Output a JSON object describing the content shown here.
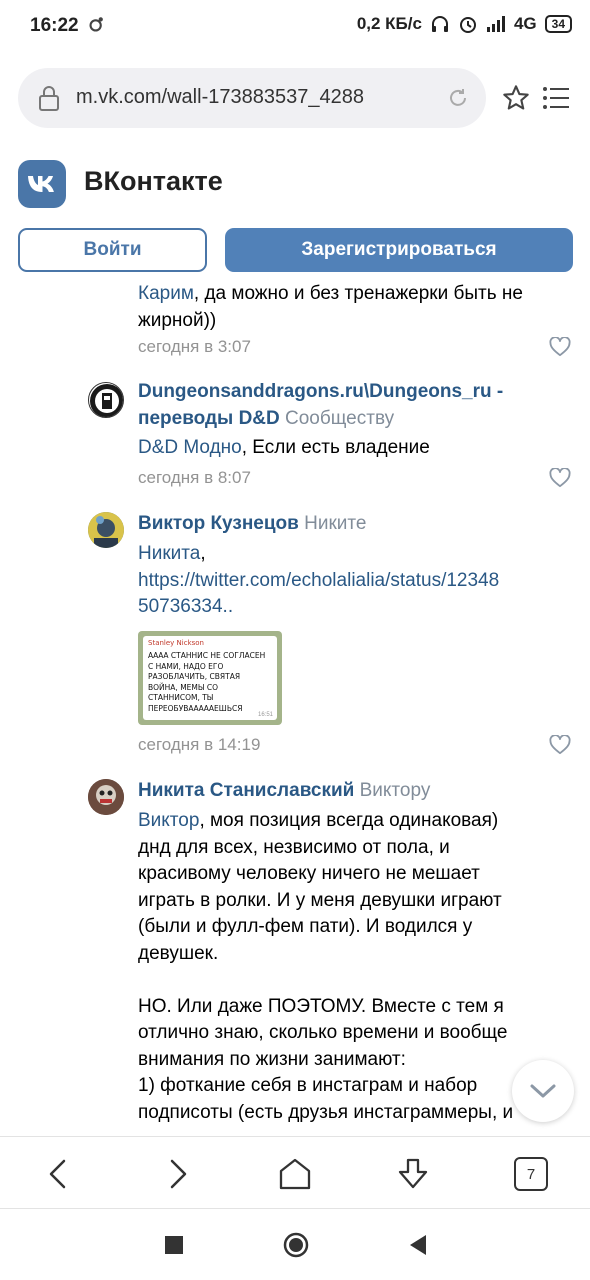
{
  "status_bar": {
    "time": "16:22",
    "network_speed": "0,2 КБ/с",
    "network_type": "4G",
    "battery": "34"
  },
  "browser": {
    "url": "m.vk.com/wall-173883537_4288",
    "tabs_count": "7"
  },
  "vk_header": {
    "title": "ВКонтакте",
    "login_label": "Войти",
    "register_label": "Зарегистрироваться",
    "accent": "#4a76a8"
  },
  "comments": [
    {
      "reply_to_name": "Карим",
      "text": ", да можно и без тренажерки быть не жирной))",
      "date": "сегодня в 3:07"
    },
    {
      "author": "Dungeonsanddragons.ru\\Dungeons_ru - переводы D&D",
      "reply_to": "Сообществу",
      "mention": "D&D Модно",
      "text": ", Если есть владение",
      "date": "сегодня в 8:07"
    },
    {
      "author": "Виктор Кузнецов",
      "reply_to": "Никите",
      "mention": "Никита",
      "text_after_mention": ",",
      "link_line1": "https://twitter.com/echolalialia/status/12348",
      "link_line2": "50736334..",
      "attachment": {
        "sender": "Stanley Nickson",
        "message": "АААА СТАННИС НЕ СОГЛАСЕН С НАМИ, НАДО ЕГО РАЗОБЛАЧИТЬ, СВЯТАЯ ВОЙНА, МЕМЫ СО СТАННИСОМ, ТЫ ПЕРЕОБУВАААААЕШЬСЯ",
        "time": "16:51"
      },
      "date": "сегодня в 14:19"
    },
    {
      "author": "Никита Станиславский",
      "reply_to": "Виктору",
      "mention": "Виктор",
      "lines": [
        ", моя позиция всегда одинаковая)",
        "днд для всех, незвисимо от пола, и",
        "красивому человеку ничего не мешает",
        "играть в ролки. И у меня девушки играют",
        "(были и фулл-фем пати). И водился у",
        "девушек.",
        "",
        "НО. Или даже ПОЭТОМУ. Вместе с тем я",
        "отлично знаю, сколько времени и вообще",
        "внимания по жизни занимают:",
        "1) фоткание себя в инстаграм и набор",
        "подписоты (есть друзья инстаграммеры, и"
      ]
    }
  ]
}
